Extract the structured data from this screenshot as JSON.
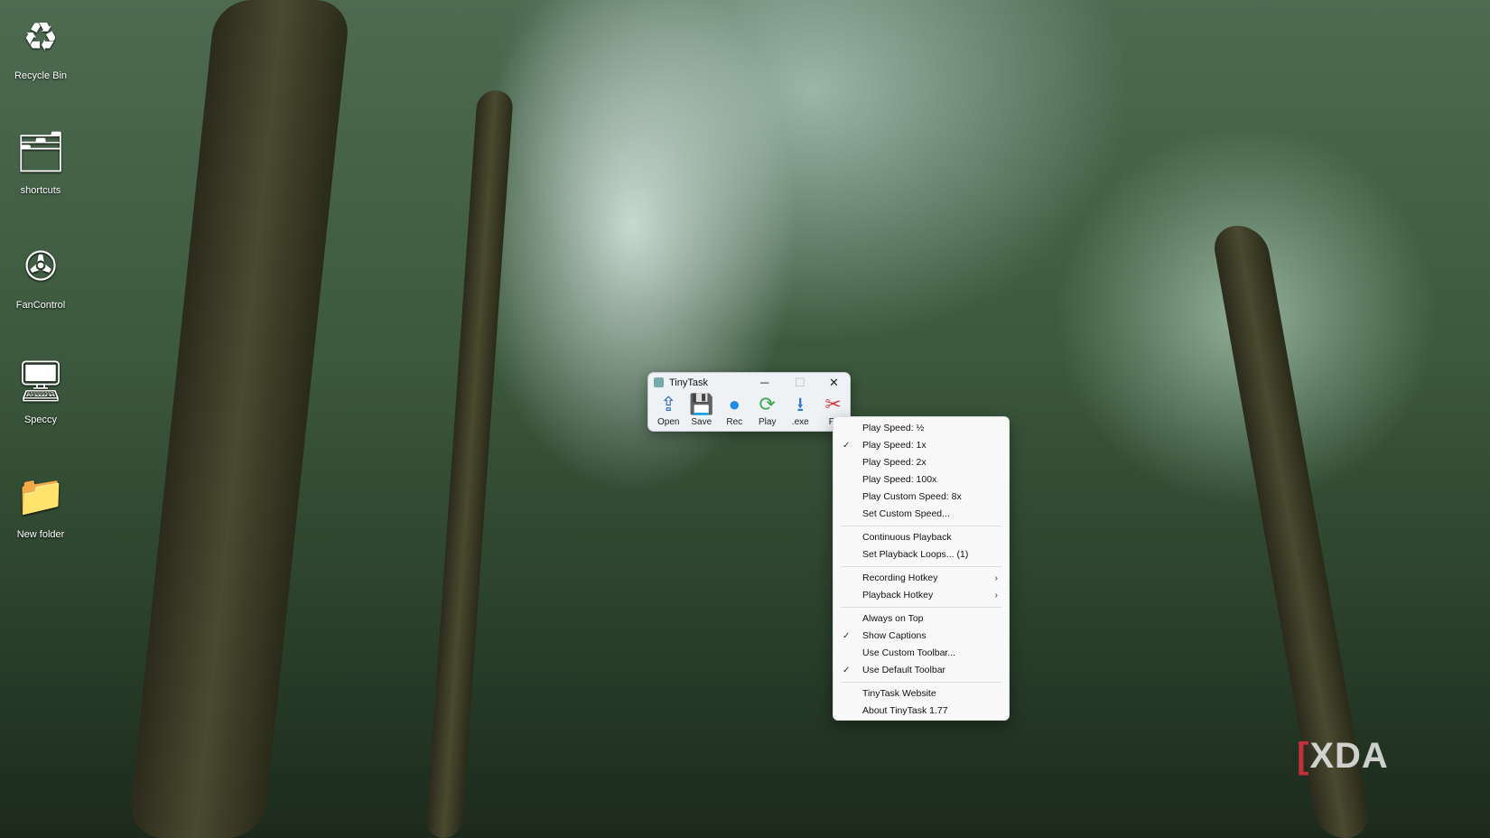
{
  "desktop": {
    "icons": [
      {
        "label": "Recycle Bin",
        "icon": "recycle-bin-icon",
        "glyph": "♻"
      },
      {
        "label": "shortcuts",
        "icon": "folder-icon",
        "glyph": "🗂"
      },
      {
        "label": "FanControl",
        "icon": "fan-icon",
        "glyph": "✇"
      },
      {
        "label": "Speccy",
        "icon": "computer-icon",
        "glyph": "🖥"
      },
      {
        "label": "New folder",
        "icon": "folder-icon",
        "glyph": "📁"
      }
    ]
  },
  "window": {
    "title": "TinyTask",
    "toolbar": [
      {
        "label": "Open",
        "glyph": "⇪",
        "color": "#2a6bbf"
      },
      {
        "label": "Save",
        "glyph": "💾",
        "color": "#8a6bb8"
      },
      {
        "label": "Rec",
        "glyph": "●",
        "color": "#1e8be6"
      },
      {
        "label": "Play",
        "glyph": "⟳",
        "color": "#3aa84b"
      },
      {
        "label": ".exe",
        "glyph": "⭳",
        "color": "#2f78d0"
      },
      {
        "label": "Pr",
        "glyph": "✂",
        "color": "#d03a3a"
      }
    ]
  },
  "menu": {
    "groups": [
      [
        {
          "label": "Play Speed:  ½"
        },
        {
          "label": "Play Speed:  1x",
          "checked": true
        },
        {
          "label": "Play Speed:  2x"
        },
        {
          "label": "Play Speed:  100x"
        },
        {
          "label": "Play Custom Speed:  8x"
        },
        {
          "label": "Set Custom Speed..."
        }
      ],
      [
        {
          "label": "Continuous Playback"
        },
        {
          "label": "Set Playback Loops...  (1)"
        }
      ],
      [
        {
          "label": "Recording Hotkey",
          "submenu": true
        },
        {
          "label": "Playback Hotkey",
          "submenu": true
        }
      ],
      [
        {
          "label": "Always on Top"
        },
        {
          "label": "Show Captions",
          "checked": true
        },
        {
          "label": "Use Custom Toolbar..."
        },
        {
          "label": "Use Default Toolbar",
          "checked": true
        }
      ],
      [
        {
          "label": "TinyTask Website"
        },
        {
          "label": "About TinyTask 1.77"
        }
      ]
    ]
  },
  "watermark": {
    "text": "XDA"
  }
}
